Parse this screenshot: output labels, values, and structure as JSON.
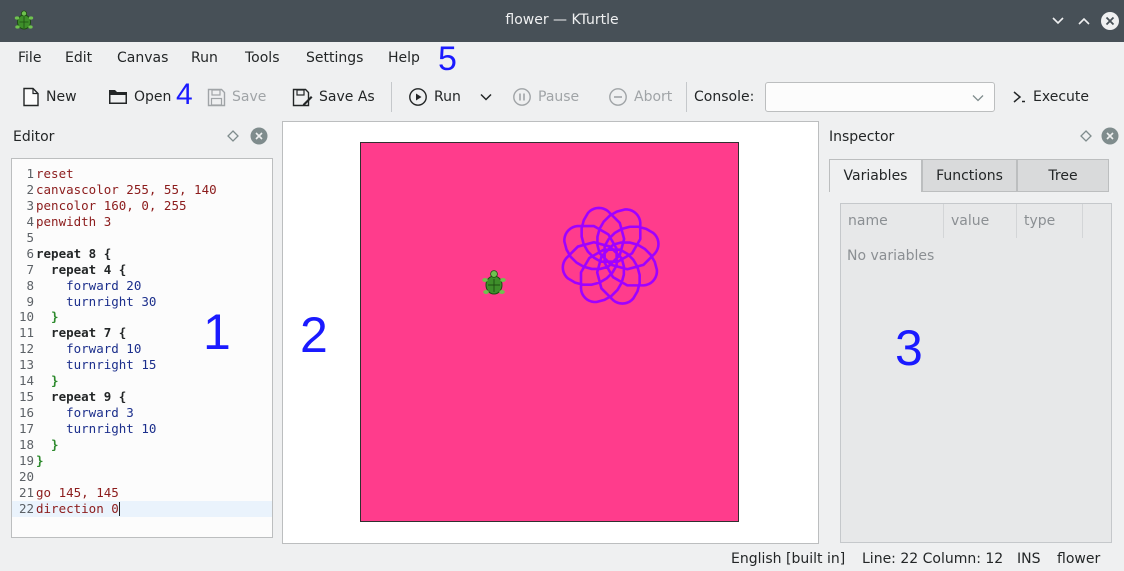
{
  "window": {
    "title": "flower — KTurtle",
    "icon": "turtle-icon"
  },
  "menu": [
    "File",
    "Edit",
    "Canvas",
    "Run",
    "Tools",
    "Settings",
    "Help"
  ],
  "toolbar": {
    "new_label": "New",
    "open_label": "Open",
    "save_label": "Save",
    "save_as_label": "Save As",
    "run_label": "Run",
    "pause_label": "Pause",
    "abort_label": "Abort",
    "console_label": "Console:",
    "console_value": "",
    "execute_label": "Execute"
  },
  "editor": {
    "title": "Editor",
    "current_line": 22,
    "lines": [
      "reset",
      "canvascolor 255, 55, 140",
      "pencolor 160, 0, 255",
      "penwidth 3",
      "",
      "repeat 8 {",
      "  repeat 4 {",
      "    forward 20",
      "    turnright 30",
      "  }",
      "  repeat 7 {",
      "    forward 10",
      "    turnright 15",
      "  }",
      "  repeat 9 {",
      "    forward 3",
      "    turnright 10",
      "  }",
      "}",
      "",
      "go 145, 145",
      "direction 0"
    ]
  },
  "canvas": {
    "background_color": "#ff3c8c",
    "pen_color": "#a000ff"
  },
  "inspector": {
    "title": "Inspector",
    "tabs": [
      "Variables",
      "Functions",
      "Tree"
    ],
    "active_tab": "Variables",
    "columns": [
      "name",
      "value",
      "type"
    ],
    "empty_text": "No variables"
  },
  "annotations": [
    "1",
    "2",
    "3",
    "4",
    "5"
  ],
  "status": {
    "language": "English [built in]",
    "position": "Line: 22 Column: 12",
    "mode": "INS",
    "file": "flower"
  },
  "colors": {
    "titlebar": "#475057",
    "accent": "#3daee9",
    "annotation": "#1a1aff"
  }
}
